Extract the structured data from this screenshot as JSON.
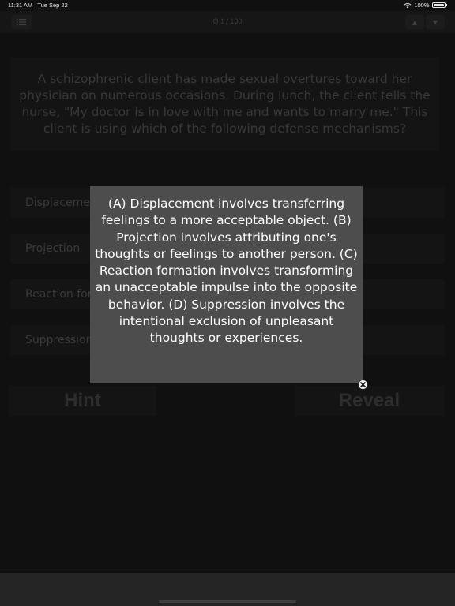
{
  "status_bar": {
    "time": "11:31 AM",
    "date": "Tue Sep 22",
    "battery": "100%",
    "icons": [
      "wifi-icon",
      "battery-icon"
    ]
  },
  "nav": {
    "title": "Q 1 / 130",
    "menu_icon": "list-icon",
    "up_icon": "▲",
    "down_icon": "▼"
  },
  "question": {
    "text": "A schizophrenic client has made sexual overtures toward her physician on numerous occasions. During lunch, the client tells the nurse, \"My doctor is in love with me and wants to marry me.\" This client is using which of the following defense mechanisms?"
  },
  "options": [
    {
      "label": "Displacement"
    },
    {
      "label": "Projection"
    },
    {
      "label": "Reaction formation"
    },
    {
      "label": "Suppression"
    }
  ],
  "buttons": {
    "hint": "Hint",
    "reveal": "Reveal"
  },
  "popup": {
    "text": "(A) Displacement involves transferring feelings to a more acceptable object. (B) Projection involves attributing one's thoughts or feelings to another person. (C) Reaction formation involves transforming an unacceptable impulse into the opposite behavior. (D) Suppression involves the intentional exclusion of unpleasant thoughts or experiences.",
    "close_icon": "close-icon"
  },
  "colors": {
    "background": "#101010",
    "popup": "#4d4d4d",
    "dim_text": "#383838"
  }
}
